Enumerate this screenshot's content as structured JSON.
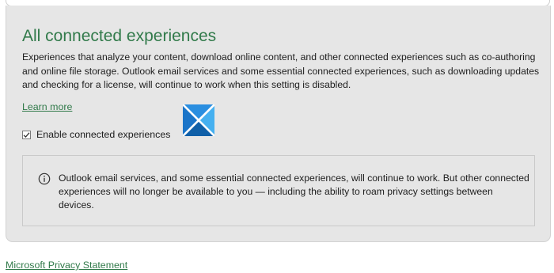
{
  "section": {
    "title": "All connected experiences",
    "description": "Experiences that analyze your content, download online content, and other connected experiences such as co-authoring and online file storage. Outlook email services and some essential connected experiences, such as downloading updates and checking for a license, will continue to work when this setting is disabled.",
    "learn_more": "Learn more"
  },
  "checkbox": {
    "label": "Enable connected experiences",
    "checked": true
  },
  "logo": {
    "icon": "windows-logo-icon",
    "colors": [
      "#1e7fd3",
      "#37a8ec",
      "#0f5fa8"
    ]
  },
  "info": {
    "icon": "info-icon",
    "text": "Outlook email services, and some essential connected experiences, will continue to work. But other connected experiences will no longer be available to you — including the ability to roam privacy settings between devices."
  },
  "footer": {
    "privacy_link": "Microsoft Privacy Statement"
  },
  "colors": {
    "accent": "#317a4a",
    "panel_background": "#e6e6e6"
  }
}
